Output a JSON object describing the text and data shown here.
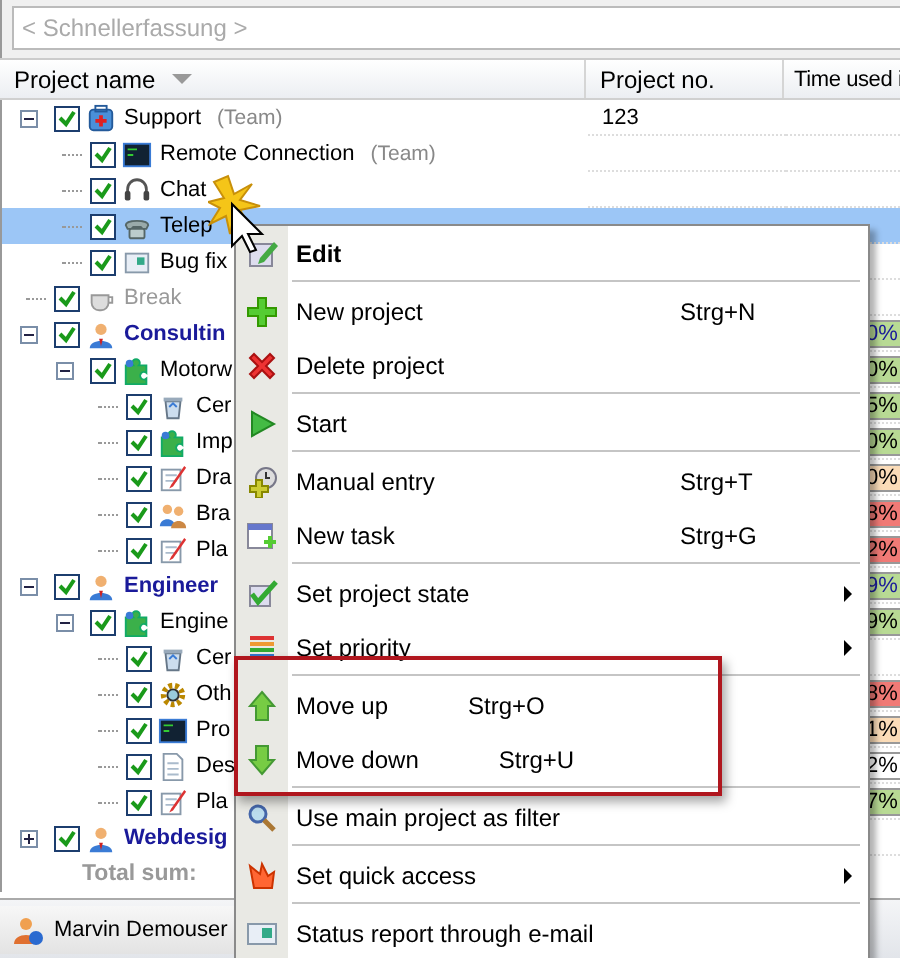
{
  "quick_entry": {
    "placeholder": "< Schnellerfassung >"
  },
  "columns": [
    {
      "label": "Project name",
      "sorted": true
    },
    {
      "label": "Project no."
    },
    {
      "label": "Time used i"
    }
  ],
  "tree": [
    {
      "name": "Support",
      "kind": "kit",
      "checked": true,
      "expanded": true,
      "selected": false,
      "disabled": false,
      "team": "(Team)",
      "project_no": "123",
      "children": [
        {
          "name": "Remote Connection",
          "kind": "terminal",
          "checked": true,
          "selected": false,
          "disabled": false,
          "team": "(Team)"
        },
        {
          "name": "Chat",
          "kind": "headset",
          "checked": true,
          "selected": false,
          "disabled": false
        },
        {
          "name": "Telep",
          "kind": "phone",
          "checked": true,
          "selected": true,
          "disabled": false
        },
        {
          "name": "Bug fix",
          "kind": "window",
          "checked": true,
          "selected": false,
          "disabled": false
        }
      ]
    },
    {
      "name": "Break",
      "kind": "cup",
      "checked": true,
      "selected": false,
      "disabled": true
    },
    {
      "name": "Consultin",
      "kind": "person",
      "checked": true,
      "expanded": true,
      "selected": false,
      "disabled": false,
      "time_used": {
        "text": "0%",
        "color": "#b8da94"
      },
      "children": [
        {
          "name": "Motorw",
          "kind": "puzzle",
          "checked": true,
          "expanded": true,
          "selected": false,
          "disabled": false,
          "time_used": {
            "text": "0%",
            "color": "#b8da94"
          },
          "children": [
            {
              "name": "Cer",
              "kind": "bin",
              "checked": true,
              "selected": false,
              "disabled": false,
              "time_used": {
                "text": "5%",
                "color": "#b8da94"
              }
            },
            {
              "name": "Imp",
              "kind": "puzzle",
              "checked": true,
              "selected": false,
              "disabled": false,
              "time_used": {
                "text": "0%",
                "color": "#b8da94"
              }
            },
            {
              "name": "Dra",
              "kind": "notepad",
              "checked": true,
              "selected": false,
              "disabled": false,
              "time_used": {
                "text": "0%",
                "color": "#fbdcb8"
              }
            },
            {
              "name": "Bra",
              "kind": "people",
              "checked": true,
              "selected": false,
              "disabled": false,
              "time_used": {
                "text": "8%",
                "color": "#f07a76"
              }
            },
            {
              "name": "Pla",
              "kind": "notepad",
              "checked": true,
              "selected": false,
              "disabled": false,
              "time_used": {
                "text": "2%",
                "color": "#f07a76"
              }
            }
          ]
        }
      ]
    },
    {
      "name": "Engineer",
      "kind": "person",
      "checked": true,
      "expanded": true,
      "selected": false,
      "disabled": false,
      "time_used": {
        "text": "9%",
        "color": "#b8da94"
      },
      "children": [
        {
          "name": "Engine",
          "kind": "puzzle",
          "checked": true,
          "expanded": true,
          "selected": false,
          "disabled": false,
          "time_used": {
            "text": "9%",
            "color": "#b8da94"
          },
          "children": [
            {
              "name": "Cer",
              "kind": "bin",
              "checked": true,
              "selected": false,
              "disabled": false
            },
            {
              "name": "Oth",
              "kind": "gear",
              "checked": true,
              "selected": false,
              "disabled": false,
              "time_used": {
                "text": "8%",
                "color": "#f07a76"
              }
            },
            {
              "name": "Pro",
              "kind": "terminal",
              "checked": true,
              "selected": false,
              "disabled": false,
              "time_used": {
                "text": "1%",
                "color": "#fbdcb8"
              }
            },
            {
              "name": "Des",
              "kind": "document",
              "checked": true,
              "selected": false,
              "disabled": false,
              "time_used": {
                "text": "2%",
                "color": "#ffffff"
              }
            },
            {
              "name": "Pla",
              "kind": "notepad",
              "checked": true,
              "selected": false,
              "disabled": false,
              "time_used": {
                "text": "7%",
                "color": "#b8da94"
              }
            }
          ]
        }
      ]
    },
    {
      "name": "Webdesig",
      "kind": "person",
      "checked": true,
      "expanded": false,
      "selected": false,
      "disabled": false
    }
  ],
  "total": {
    "label": "Total sum:"
  },
  "status_bar": {
    "user": "Marvin Demouser"
  },
  "context_menu": {
    "items": [
      {
        "label": "Edit",
        "kind": "edit",
        "bold": true,
        "submenu": false,
        "highlighted": false,
        "separator_after": true
      },
      {
        "label": "New project",
        "kind": "add",
        "shortcut": "Strg+N",
        "bold": false,
        "submenu": false,
        "highlighted": false,
        "separator_after": false
      },
      {
        "label": "Delete project",
        "kind": "delete",
        "bold": false,
        "submenu": false,
        "highlighted": false,
        "separator_after": true
      },
      {
        "label": "Start",
        "kind": "start",
        "bold": false,
        "submenu": false,
        "highlighted": false,
        "separator_after": true
      },
      {
        "label": "Manual entry",
        "kind": "manual",
        "shortcut": "Strg+T",
        "bold": false,
        "submenu": false,
        "highlighted": false,
        "separator_after": false
      },
      {
        "label": "New task",
        "kind": "task",
        "shortcut": "Strg+G",
        "bold": false,
        "submenu": false,
        "highlighted": false,
        "separator_after": true
      },
      {
        "label": "Set project state",
        "kind": "state",
        "bold": false,
        "submenu": true,
        "highlighted": false,
        "separator_after": false
      },
      {
        "label": "Set priority",
        "kind": "priority",
        "bold": false,
        "submenu": true,
        "highlighted": false,
        "separator_after": true
      },
      {
        "label": "Move up",
        "kind": "up",
        "shortcut": "Strg+O",
        "bold": false,
        "submenu": false,
        "highlighted": true,
        "separator_after": false
      },
      {
        "label": "Move down",
        "kind": "down",
        "shortcut": "Strg+U",
        "bold": false,
        "submenu": false,
        "highlighted": true,
        "separator_after": true
      },
      {
        "label": "Use main project as filter",
        "kind": "filter",
        "bold": false,
        "submenu": false,
        "highlighted": false,
        "separator_after": true
      },
      {
        "label": "Set quick access",
        "kind": "quick",
        "bold": false,
        "submenu": true,
        "highlighted": false,
        "separator_after": true
      },
      {
        "label": "Status report through e-mail",
        "kind": "report",
        "bold": false,
        "submenu": false,
        "highlighted": false,
        "separator_after": false
      }
    ]
  }
}
